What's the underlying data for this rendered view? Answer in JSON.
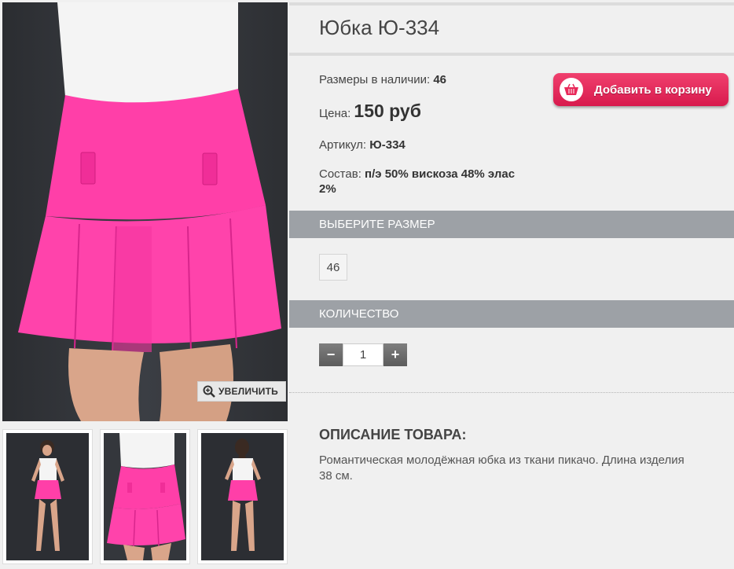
{
  "product": {
    "title": "Юбка Ю-334",
    "sizes_label": "Размеры в наличии:",
    "sizes_value": "46",
    "price_label": "Цена:",
    "price_value": "150 руб",
    "sku_label": "Артикул:",
    "sku_value": "Ю-334",
    "composition_label": "Состав:",
    "composition_value_line1": "п/э 50% вискоза 48% элас",
    "composition_value_line2": "2%"
  },
  "cart_button": {
    "label": "Добавить в корзину",
    "icon": "shopping-basket-icon",
    "color": "#e8295a"
  },
  "gallery": {
    "zoom_label": "УВЕЛИЧИТЬ",
    "zoom_icon": "zoom-in-icon",
    "skirt_color": "#ff3fa8",
    "background_color": "#2f3136"
  },
  "size_section": {
    "header": "ВЫБЕРИТЕ РАЗМЕР",
    "options": [
      "46"
    ]
  },
  "quantity_section": {
    "header": "КОЛИЧЕСТВО",
    "minus": "−",
    "plus": "+",
    "value": "1"
  },
  "description": {
    "header": "ОПИСАНИЕ ТОВАРА:",
    "text": "Романтическая молодёжная юбка из ткани пикачо. Длина изделия 38 см."
  }
}
